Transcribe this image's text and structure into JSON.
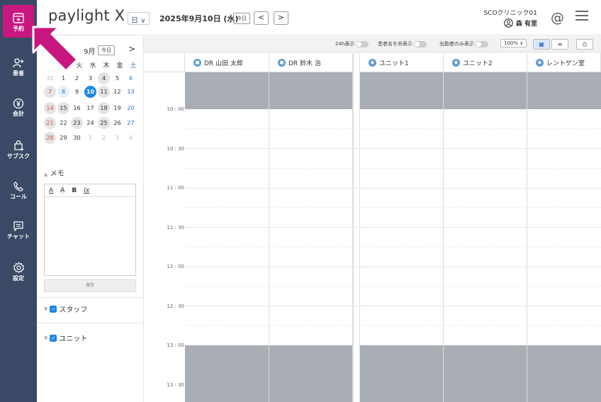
{
  "app": {
    "logo": "paylight X"
  },
  "nav": [
    {
      "id": "schedule",
      "label": "予約",
      "icon": "calendar-plus-icon"
    },
    {
      "id": "patient",
      "label": "患者",
      "icon": "user-plus-icon"
    },
    {
      "id": "billing",
      "label": "会計",
      "icon": "yen-icon"
    },
    {
      "id": "subscription",
      "label": "サブスク",
      "icon": "bag-icon"
    },
    {
      "id": "call",
      "label": "コール",
      "icon": "phone-icon"
    },
    {
      "id": "chat",
      "label": "チャット",
      "icon": "chat-icon"
    },
    {
      "id": "settings",
      "label": "設定",
      "icon": "gear-icon"
    }
  ],
  "header": {
    "view_mode": "日",
    "date": "2025年9月10日 (水)",
    "today": "今日",
    "prev": "<",
    "next": ">",
    "clinic": "SCOクリニック01",
    "user": "森 有里"
  },
  "calendar": {
    "month": "9月",
    "today": "今日",
    "next": ">",
    "weekdays": [
      "月",
      "火",
      "水",
      "木",
      "金",
      "土"
    ],
    "weeks": [
      [
        "31",
        "1",
        "2",
        "3",
        "4",
        "5",
        "6"
      ],
      [
        "7",
        "8",
        "9",
        "10",
        "11",
        "12",
        "13"
      ],
      [
        "14",
        "15",
        "16",
        "17",
        "18",
        "19",
        "20"
      ],
      [
        "21",
        "22",
        "23",
        "24",
        "25",
        "26",
        "27"
      ],
      [
        "28",
        "29",
        "30",
        "1",
        "2",
        "3",
        "4"
      ]
    ],
    "selected": "10"
  },
  "memo": {
    "title": "メモ",
    "tools": [
      "A",
      "A",
      "B",
      "Ix"
    ],
    "save": "保存"
  },
  "sections": {
    "staff": "スタッフ",
    "unit": "ユニット"
  },
  "toolbar": {
    "toggle_24h": "24h表示",
    "toggle_hide_name": "患者名を非表示",
    "toggle_attend": "出勤者のみ表示",
    "zoom": "100%"
  },
  "columns": [
    {
      "label": "DR 山田 太郎",
      "kind": "staff"
    },
    {
      "label": "DR 鈴木 治",
      "kind": "staff"
    },
    {
      "label": "ユニット1",
      "kind": "unit"
    },
    {
      "label": "ユニット2",
      "kind": "unit"
    },
    {
      "label": "レントゲン室",
      "kind": "unit"
    }
  ],
  "times": [
    "10 : 00",
    "10 : 30",
    "11 : 00",
    "11 : 30",
    "12 : 00",
    "12 : 30",
    "13 : 00",
    "13 : 30"
  ],
  "colors": {
    "rail": "#3a4a66",
    "active": "#c8177f",
    "accent": "#1e88e5",
    "blocked": "#a9adb4"
  }
}
